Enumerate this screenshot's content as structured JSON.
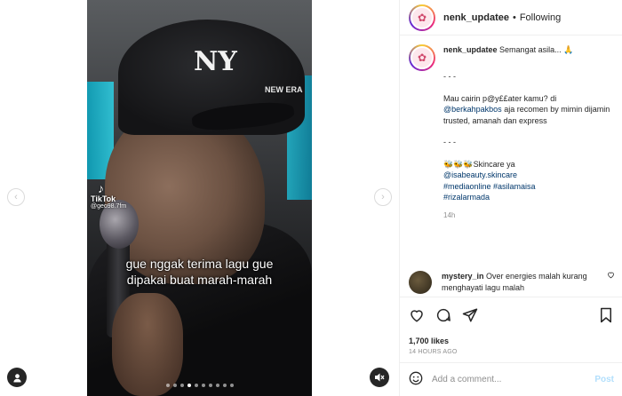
{
  "media": {
    "tiktok_label": "TikTok",
    "tiktok_id": "@geo98.7fm",
    "cap_logo": "NY",
    "cap_brand": "NEW ERA",
    "subtitle_line1": "gue nggak terima lagu gue",
    "subtitle_line2": "dipakai buat marah-marah",
    "carousel_count": 10,
    "carousel_active_index": 3
  },
  "header": {
    "username": "nenk_updatee",
    "separator": "•",
    "follow_label": "Following"
  },
  "caption": {
    "username": "nenk_updatee",
    "intro": "Semangat asila... 🙏",
    "sep1": "- - -",
    "line_a": "Mau cairin p@y££ater kamu? di",
    "mention1": "@berkahpakbos",
    "line_b": " aja recomen by mimin dijamin trusted, amanah dan express",
    "sep2": "- - -",
    "skincare": "🐝🐝🐝Skincare ya",
    "mention2": "@isabeauty.skincare",
    "tags_line1": "#mediaonline #asilamaisa",
    "tags_line2": "#rizalarmada",
    "time_ago": "14h"
  },
  "comment": {
    "username": "mystery_in",
    "text": "Over energies malah kurang menghayati lagu malah"
  },
  "actions": {
    "likes": "1,700 likes",
    "posted": "14 HOURS AGO"
  },
  "add_comment": {
    "placeholder": "Add a comment...",
    "post_label": "Post"
  },
  "icons": {
    "nav_left": "chevron-left-icon",
    "nav_right": "chevron-right-icon",
    "tag": "user-tag-icon",
    "mute": "speaker-mute-icon",
    "like": "heart-icon",
    "comment": "comment-icon",
    "share": "paper-plane-icon",
    "save": "bookmark-icon",
    "emoji": "smiley-icon"
  }
}
